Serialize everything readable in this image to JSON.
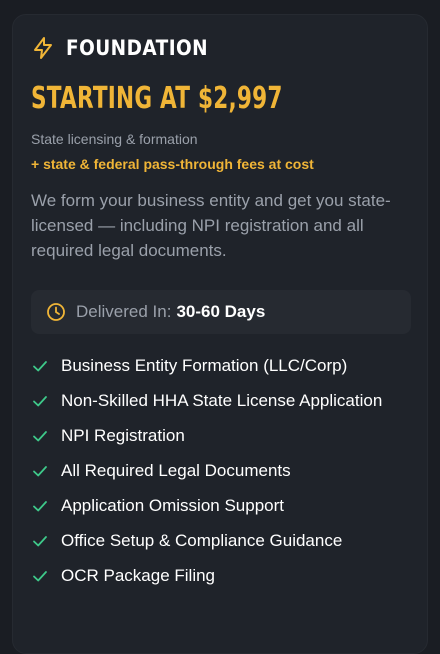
{
  "plan": {
    "icon": "lightning-bolt-icon",
    "name": "FOUNDATION",
    "price": "STARTING AT $2,997",
    "subtitle": "State licensing & formation",
    "fees_note": "+ state & federal pass-through fees at cost",
    "description": "We form your business entity and get you state-licensed — including NPI registration and all required legal documents."
  },
  "delivery": {
    "icon": "clock-icon",
    "label": "Delivered In:",
    "value": "30-60 Days"
  },
  "features": [
    "Business Entity Formation (LLC/Corp)",
    "Non-Skilled HHA State License Application",
    "NPI Registration",
    "All Required Legal Documents",
    "Application Omission Support",
    "Office Setup & Compliance Guidance",
    "OCR Package Filing"
  ],
  "colors": {
    "accent": "#f0b537",
    "check": "#3ec98a",
    "background": "#1a1d23",
    "card": "#1f232a"
  }
}
